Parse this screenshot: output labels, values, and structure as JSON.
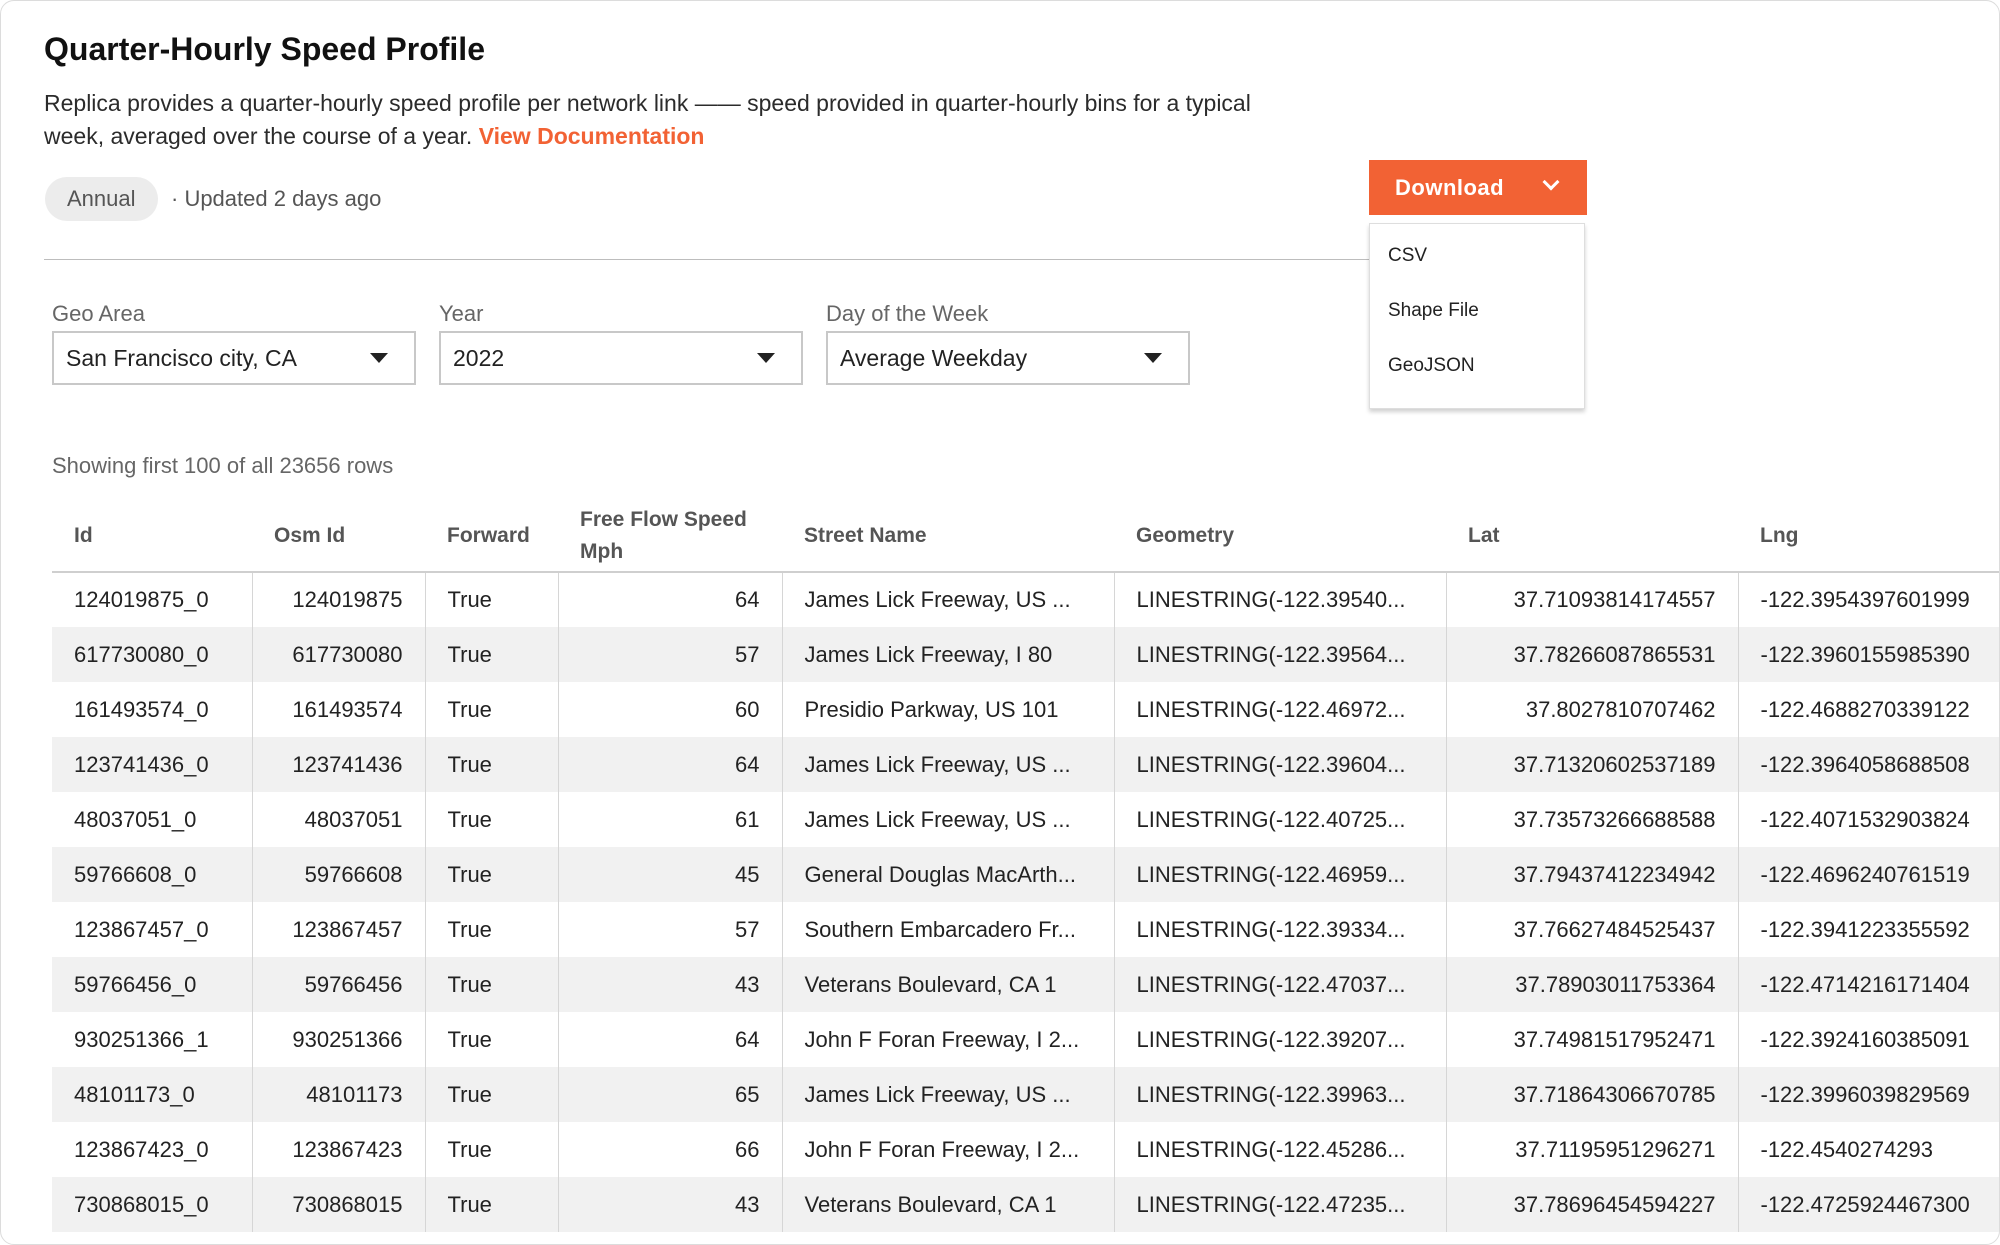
{
  "header": {
    "title": "Quarter-Hourly Speed Profile",
    "description": "Replica provides a quarter-hourly speed profile per network link —— speed provided in quarter-hourly bins for a typical week, averaged over the course of a year.",
    "doc_link": "View Documentation",
    "badge": "Annual",
    "updated": "· Updated 2 days ago"
  },
  "download": {
    "label": "Download",
    "options": [
      "CSV",
      "Shape File",
      "GeoJSON"
    ]
  },
  "filters": [
    {
      "label": "Geo Area",
      "value": "San Francisco city, CA"
    },
    {
      "label": "Year",
      "value": "2022"
    },
    {
      "label": "Day of the Week",
      "value": "Average Weekday"
    }
  ],
  "table": {
    "rows_note": "Showing first 100 of all 23656 rows",
    "columns": [
      "Id",
      "Osm Id",
      "Forward",
      "Free Flow Speed Mph",
      "Street Name",
      "Geometry",
      "Lat",
      "Lng"
    ],
    "rows": [
      [
        "124019875_0",
        "124019875",
        "True",
        "64",
        "James Lick Freeway, US ...",
        "LINESTRING(-122.39540...",
        "37.71093814174557",
        "-122.3954397601999"
      ],
      [
        "617730080_0",
        "617730080",
        "True",
        "57",
        "James Lick Freeway, I 80",
        "LINESTRING(-122.39564...",
        "37.78266087865531",
        "-122.3960155985390"
      ],
      [
        "161493574_0",
        "161493574",
        "True",
        "60",
        "Presidio Parkway, US 101",
        "LINESTRING(-122.46972...",
        "37.8027810707462",
        "-122.4688270339122"
      ],
      [
        "123741436_0",
        "123741436",
        "True",
        "64",
        "James Lick Freeway, US ...",
        "LINESTRING(-122.39604...",
        "37.71320602537189",
        "-122.3964058688508"
      ],
      [
        "48037051_0",
        "48037051",
        "True",
        "61",
        "James Lick Freeway, US ...",
        "LINESTRING(-122.40725...",
        "37.73573266688588",
        "-122.4071532903824"
      ],
      [
        "59766608_0",
        "59766608",
        "True",
        "45",
        "General Douglas MacArth...",
        "LINESTRING(-122.46959...",
        "37.79437412234942",
        "-122.4696240761519"
      ],
      [
        "123867457_0",
        "123867457",
        "True",
        "57",
        "Southern Embarcadero Fr...",
        "LINESTRING(-122.39334...",
        "37.76627484525437",
        "-122.3941223355592"
      ],
      [
        "59766456_0",
        "59766456",
        "True",
        "43",
        "Veterans Boulevard, CA 1",
        "LINESTRING(-122.47037...",
        "37.78903011753364",
        "-122.4714216171404"
      ],
      [
        "930251366_1",
        "930251366",
        "True",
        "64",
        "John F Foran Freeway, I 2...",
        "LINESTRING(-122.39207...",
        "37.74981517952471",
        "-122.3924160385091"
      ],
      [
        "48101173_0",
        "48101173",
        "True",
        "65",
        "James Lick Freeway, US ...",
        "LINESTRING(-122.39963...",
        "37.71864306670785",
        "-122.3996039829569"
      ],
      [
        "123867423_0",
        "123867423",
        "True",
        "66",
        "John F Foran Freeway, I 2...",
        "LINESTRING(-122.45286...",
        "37.71195951296271",
        "-122.4540274293"
      ],
      [
        "730868015_0",
        "730868015",
        "True",
        "43",
        "Veterans Boulevard, CA 1",
        "LINESTRING(-122.47235...",
        "37.78696454594227",
        "-122.4725924467300"
      ]
    ]
  }
}
